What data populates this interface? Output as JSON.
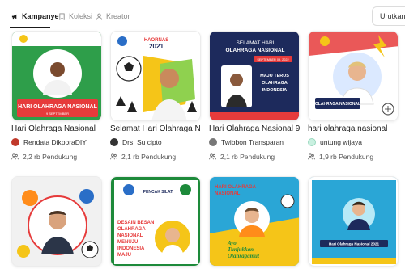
{
  "tabs": [
    {
      "label": "Kampanye",
      "icon": "megaphone-icon",
      "active": true
    },
    {
      "label": "Koleksi",
      "icon": "bookmark-icon",
      "active": false
    },
    {
      "label": "Kreator",
      "icon": "user-icon",
      "active": false
    }
  ],
  "sort_label": "Urutkan be",
  "cards_row1": [
    {
      "title": "Hari Olahraga Nasional",
      "author": "Rendata DikporaDIY",
      "supporters": "2,2 rb Pendukung"
    },
    {
      "title": "Selamat Hari Olahraga N",
      "author": "Drs. Su cipto",
      "supporters": "2,1 rb Pendukung"
    },
    {
      "title": "Hari Olahraga Nasional 9",
      "author": "Twibbon Transparan",
      "supporters": "2,1 rb Pendukung"
    },
    {
      "title": "hari olahraga nasional",
      "author": "untung wijaya",
      "supporters": "1,9 rb Pendukung"
    }
  ],
  "poster_text": {
    "p1_main": "HARI OLAHRAGA NASIONAL",
    "p1_sub": "9 SEPTEMBER",
    "p2_top": "HAORNAS",
    "p2_year": "2021",
    "p3_l1": "SELAMAT HARI",
    "p3_l2": "OLAHRAGA NASIONAL",
    "p3_date": "SEPTEMBER 09, 2022",
    "p3_m1": "MAJU TERUS",
    "p3_m2": "OLAHRAGA",
    "p3_m3": "INDONESIA",
    "p4_main": "OLAHRAGA NASIONAL",
    "p6_top": "PENCAK SILAT",
    "p6_l1": "DESAIN BESAN",
    "p6_l2": "OLAHRAGA",
    "p6_l3": "NASIONAL",
    "p6_l4": "MENUJU",
    "p6_l5": "INDONESIA",
    "p6_l6": "MAJU",
    "p7_l1": "HARI OLAHRAGA",
    "p7_l2": "NASIONAL",
    "p7_l3": "Ayo",
    "p7_l4": "Tunjukkan",
    "p7_l5": "Olahragamu!",
    "p8_main": "Hari Olahraga Nasional 2021"
  },
  "colors": {
    "accent_red": "#e63b3b",
    "navy": "#1d2a5c",
    "green": "#2e9e4a",
    "yellow": "#f5c518"
  }
}
